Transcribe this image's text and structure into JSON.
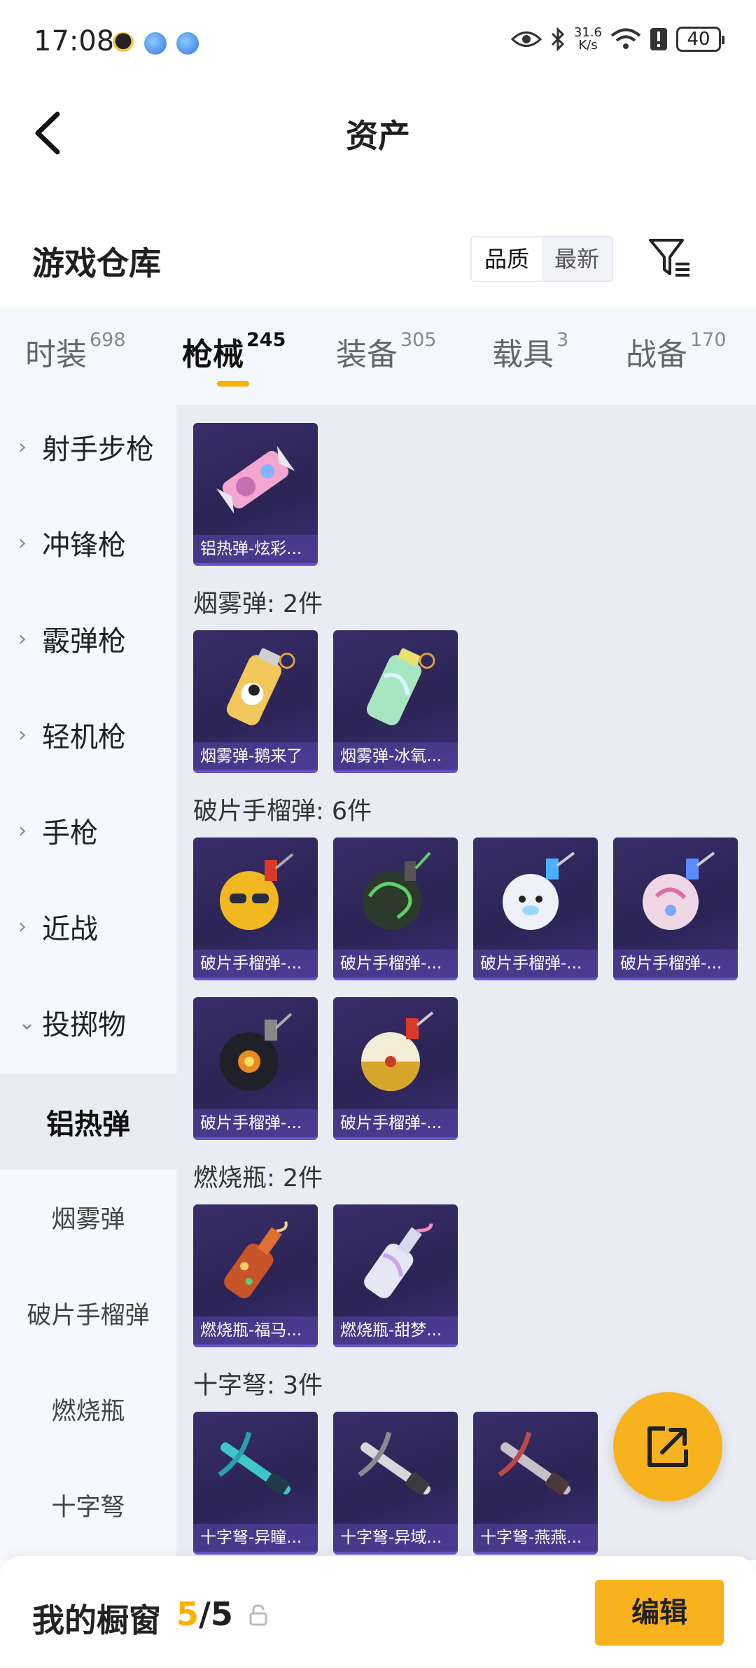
{
  "status_bar": {
    "time": "17:08",
    "network_speed": "31.6\nK/s",
    "battery": "40"
  },
  "header": {
    "title": "资产"
  },
  "warehouse": {
    "title": "游戏仓库",
    "sort": [
      "品质",
      "最新"
    ]
  },
  "tabs": [
    {
      "label": "时装",
      "count": "698"
    },
    {
      "label": "枪械",
      "count": "245"
    },
    {
      "label": "装备",
      "count": "305"
    },
    {
      "label": "载具",
      "count": "3"
    },
    {
      "label": "战备",
      "count": "170"
    }
  ],
  "sidebar": {
    "categories": [
      "射手步枪",
      "冲锋枪",
      "霰弹枪",
      "轻机枪",
      "手枪",
      "近战",
      "投掷物"
    ],
    "subcategories": [
      "铝热弹",
      "烟雾弹",
      "破片手榴弹",
      "燃烧瓶",
      "十字弩"
    ]
  },
  "content": {
    "groups": [
      {
        "label": "",
        "items": [
          "铝热弹-炫彩..."
        ]
      },
      {
        "label": "烟雾弹: 2件",
        "items": [
          "烟雾弹-鹅来了",
          "烟雾弹-冰氧..."
        ]
      },
      {
        "label": "破片手榴弹: 6件",
        "items": [
          "破片手榴弹-...",
          "破片手榴弹-...",
          "破片手榴弹-...",
          "破片手榴弹-...",
          "破片手榴弹-...",
          "破片手榴弹-..."
        ]
      },
      {
        "label": "燃烧瓶: 2件",
        "items": [
          "燃烧瓶-福马...",
          "燃烧瓶-甜梦..."
        ]
      },
      {
        "label": "十字弩: 3件",
        "items": [
          "十字弩-异瞳...",
          "十字弩-异域...",
          "十字弩-燕燕..."
        ]
      }
    ]
  },
  "showcase": {
    "title": "我的橱窗",
    "used": "5",
    "separator": "/",
    "total": "5",
    "edit_label": "编辑"
  },
  "colors": {
    "accent": "#f7b21e",
    "card_bg": "#2b2454",
    "content_bg": "#e9edf3"
  }
}
